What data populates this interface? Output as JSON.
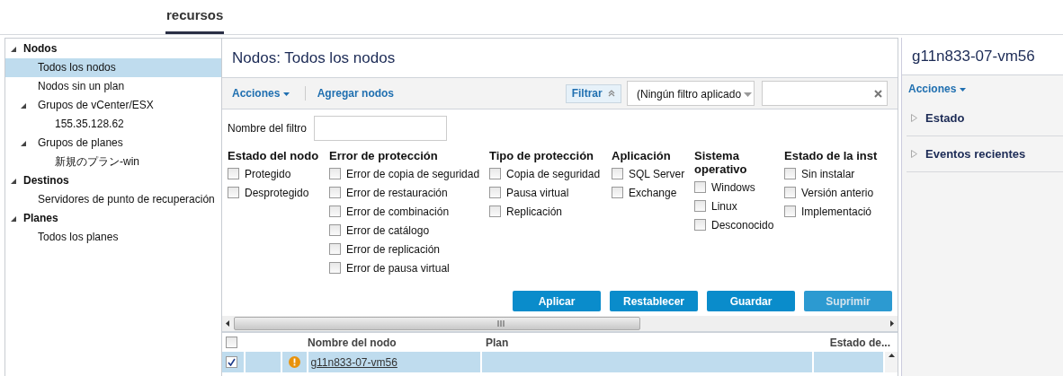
{
  "header": {
    "tabs": [
      {
        "label": "recursos",
        "selected": true
      }
    ]
  },
  "tree": [
    {
      "label": "Nodos",
      "expanded": true,
      "selected": false,
      "children": [
        {
          "label": "Todos los nodos",
          "selected": true
        },
        {
          "label": "Nodos sin un plan",
          "selected": false
        },
        {
          "label": "Grupos de vCenter/ESX",
          "expanded": true,
          "selected": false,
          "children": [
            {
              "label": "155.35.128.62",
              "selected": false
            }
          ]
        },
        {
          "label": "Grupos de planes",
          "expanded": true,
          "selected": false,
          "children": [
            {
              "label": "新規のプラン-win",
              "selected": false
            }
          ]
        }
      ]
    },
    {
      "label": "Destinos",
      "expanded": true,
      "selected": false,
      "children": [
        {
          "label": "Servidores de punto de recuperación",
          "selected": false
        }
      ]
    },
    {
      "label": "Planes",
      "expanded": true,
      "selected": false,
      "children": [
        {
          "label": "Todos los planes",
          "selected": false
        }
      ]
    }
  ],
  "main": {
    "title": "Nodos:  Todos los nodos",
    "actions": "Acciones",
    "add_nodes": "Agregar nodos",
    "filter_button": "Filtrar",
    "filter_select": "(Ningún filtro aplicado",
    "filter_name_label": "Nombre del filtro",
    "filter_groups": [
      {
        "title": "Estado del nodo",
        "options": [
          {
            "label": "Protegido",
            "checked": false
          },
          {
            "label": "Desprotegido",
            "checked": false
          }
        ]
      },
      {
        "title": "Error de protección",
        "options": [
          {
            "label": "Error de copia de seguridad",
            "checked": false
          },
          {
            "label": "Error de restauración",
            "checked": false
          },
          {
            "label": "Error de combinación",
            "checked": false
          },
          {
            "label": "Error de catálogo",
            "checked": false
          },
          {
            "label": "Error de replicación",
            "checked": false
          },
          {
            "label": "Error de pausa virtual",
            "checked": false
          }
        ]
      },
      {
        "title": "Tipo de protección",
        "options": [
          {
            "label": "Copia de seguridad",
            "checked": false
          },
          {
            "label": "Pausa virtual",
            "checked": false
          },
          {
            "label": "Replicación",
            "checked": false
          }
        ]
      },
      {
        "title": "Aplicación",
        "options": [
          {
            "label": "SQL Server",
            "checked": false
          },
          {
            "label": "Exchange",
            "checked": false
          }
        ]
      },
      {
        "title": "Sistema operativo",
        "options": [
          {
            "label": "Windows",
            "checked": false
          },
          {
            "label": "Linux",
            "checked": false
          },
          {
            "label": "Desconocido",
            "checked": false
          }
        ]
      },
      {
        "title": "Estado de la inst",
        "options": [
          {
            "label": "Sin instalar",
            "checked": false
          },
          {
            "label": "Versión anterio",
            "checked": false
          },
          {
            "label": "Implementació",
            "checked": false
          }
        ]
      }
    ],
    "buttons": [
      {
        "label": "Aplicar",
        "disabled": false
      },
      {
        "label": "Restablecer",
        "disabled": false
      },
      {
        "label": "Guardar",
        "disabled": false
      },
      {
        "label": "Suprimir",
        "disabled": true
      }
    ],
    "table": {
      "all_checked": false,
      "columns": [
        "Nombre del nodo",
        "Plan",
        "Estado de..."
      ],
      "rows": [
        {
          "checked": true,
          "selected": true,
          "warning": true,
          "name": "g11n833-07-vm56",
          "plan": "",
          "status": ""
        }
      ]
    }
  },
  "details": {
    "title": "g11n833-07-vm56",
    "actions": "Acciones",
    "sections": [
      {
        "label": "Estado",
        "expanded": false
      },
      {
        "label": "Eventos recientes",
        "expanded": false
      }
    ]
  }
}
